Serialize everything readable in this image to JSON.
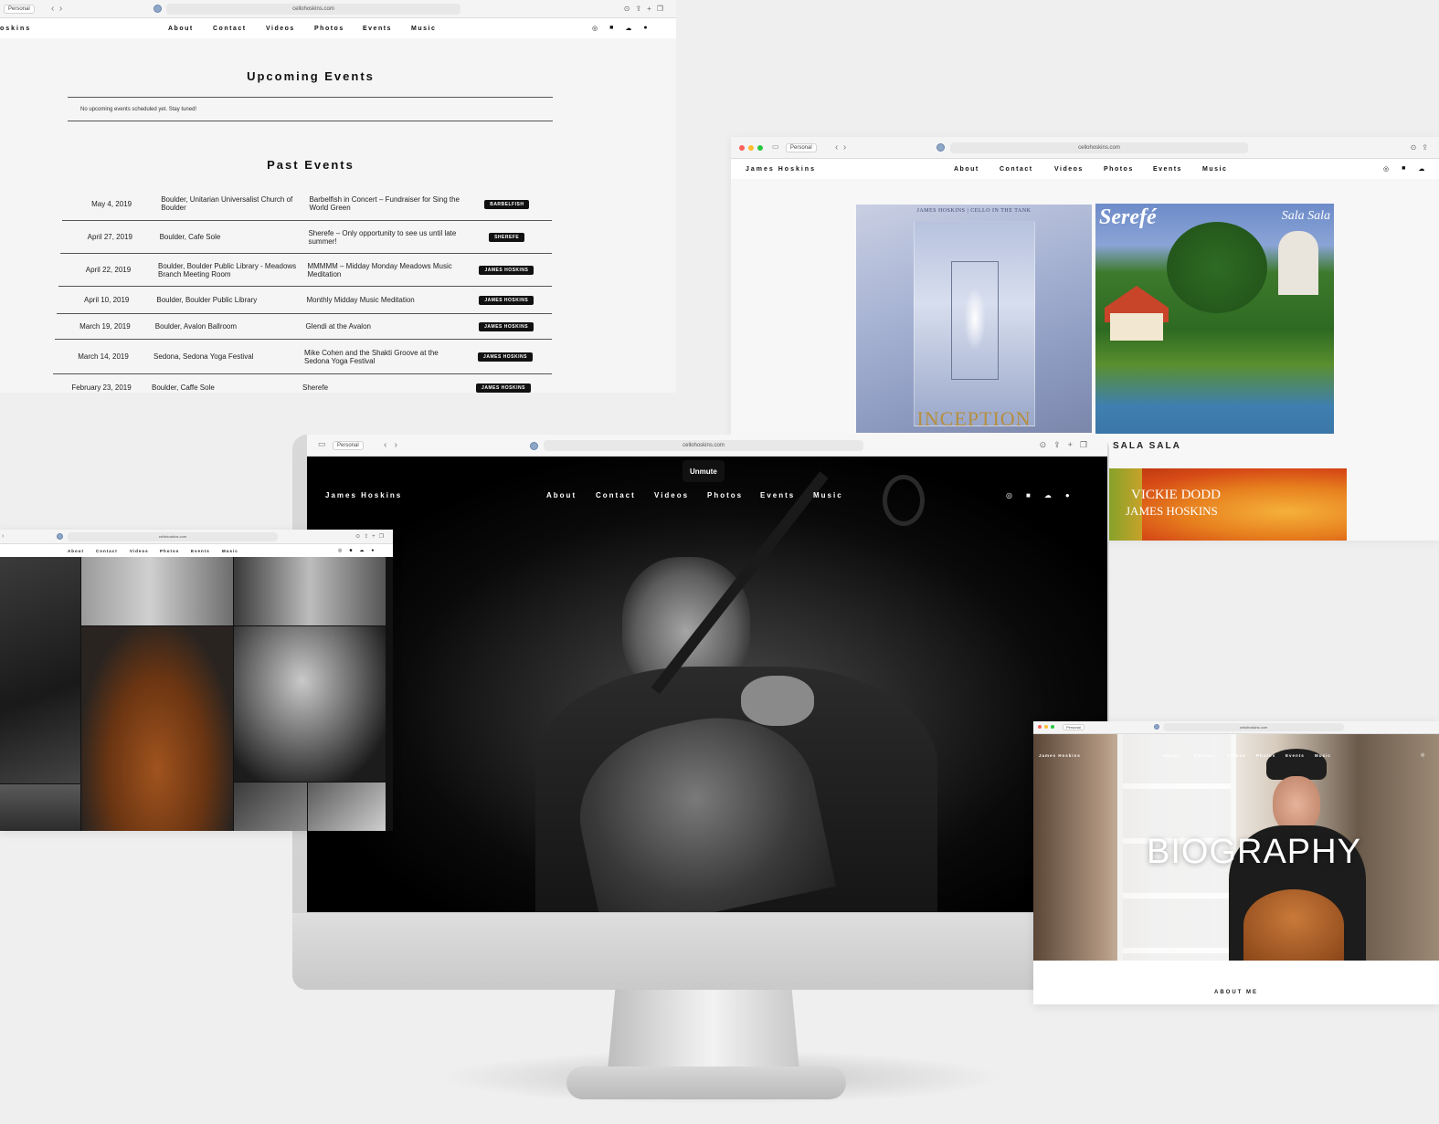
{
  "site": {
    "brand": "James Hoskins",
    "brand_partial": "oskins",
    "url": "cellohoskins.com",
    "profile_label": "Personal",
    "nav": [
      "About",
      "Contact",
      "Videos",
      "Photos",
      "Events",
      "Music"
    ],
    "social_icons": [
      "instagram-icon",
      "facebook-icon",
      "soundcloud-icon",
      "spotify-icon"
    ]
  },
  "events_page": {
    "upcoming_title": "Upcoming Events",
    "upcoming_empty": "No upcoming events scheduled yet. Stay tuned!",
    "past_title": "Past Events",
    "past_events": [
      {
        "date": "May 4, 2019",
        "place": "Boulder, Unitarian Universalist Church of Boulder",
        "title": "Barbelfish in Concert – Fundraiser for Sing the World Green",
        "tag": "BARBELFISH"
      },
      {
        "date": "April 27, 2019",
        "place": "Boulder, Cafe Sole",
        "title": "Sherefe – Only opportunity to see us until late summer!",
        "tag": "SHEREFE"
      },
      {
        "date": "April 22, 2019",
        "place": "Boulder, Boulder Public Library - Meadows Branch Meeting Room",
        "title": "MMMMM – Midday Monday Meadows Music Meditation",
        "tag": "JAMES HOSKINS"
      },
      {
        "date": "April 10, 2019",
        "place": "Boulder, Boulder Public Library",
        "title": "Monthly Midday Music Meditation",
        "tag": "JAMES HOSKINS"
      },
      {
        "date": "March 19, 2019",
        "place": "Boulder, Avalon Ballroom",
        "title": "Glendi at the Avalon",
        "tag": "JAMES HOSKINS"
      },
      {
        "date": "March 14, 2019",
        "place": "Sedona, Sedona Yoga Festival",
        "title": "Mike Cohen and the Shakti Groove at the Sedona Yoga Festival",
        "tag": "JAMES HOSKINS"
      },
      {
        "date": "February 23, 2019",
        "place": "Boulder, Caffe Sole",
        "title": "Sherefe",
        "tag": "JAMES HOSKINS"
      }
    ]
  },
  "music_page": {
    "album1_header": "JAMES HOSKINS | CELLO IN THE TANK",
    "album1_title": "INCEPTION",
    "album2_title": "Serefé",
    "album2_subtitle": "Sala Sala",
    "album2_caption": "SALA SALA",
    "album3_line1": "VICKIE DODD",
    "album3_line2": "JAMES HOSKINS"
  },
  "home_page": {
    "unmute_label": "Unmute"
  },
  "bio_page": {
    "hero_title": "BIOGRAPHY",
    "section_label": "ABOUT ME"
  },
  "colors": {
    "page_bg": "#efefef",
    "tag_bg": "#111111",
    "hero_bg": "#000000"
  }
}
